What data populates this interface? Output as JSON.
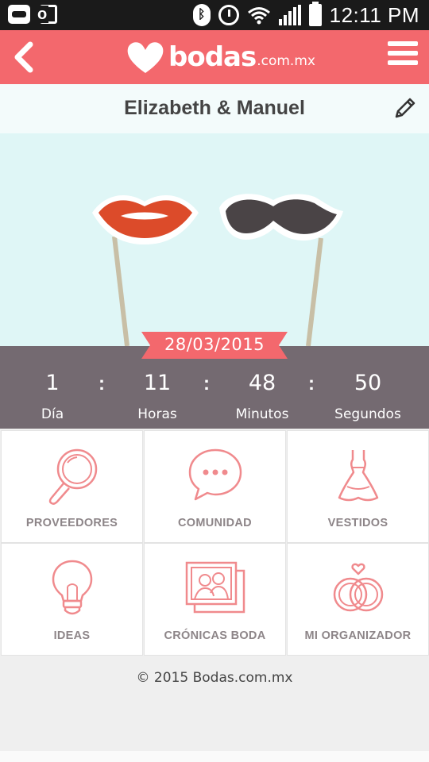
{
  "status_bar": {
    "time": "12:11 PM",
    "icons": [
      "game-controller-icon",
      "outlook-icon",
      "bluetooth-icon",
      "alarm-icon",
      "wifi-icon",
      "signal-icon",
      "battery-icon"
    ]
  },
  "app_bar": {
    "logo_word": "bodas",
    "logo_domain": ".com.mx",
    "back_icon": "chevron-left-icon",
    "menu_icon": "hamburger-menu-icon",
    "color": "#f3686d"
  },
  "couple": {
    "names": "Elizabeth & Manuel",
    "edit_icon": "pencil-icon"
  },
  "hero": {
    "props": [
      "lips-icon",
      "mustache-icon"
    ]
  },
  "countdown": {
    "date": "28/03/2015",
    "units": [
      {
        "value": "1",
        "label": "Día"
      },
      {
        "value": "11",
        "label": "Horas"
      },
      {
        "value": "48",
        "label": "Minutos"
      },
      {
        "value": "50",
        "label": "Segundos"
      }
    ],
    "separator": ":"
  },
  "menu_tiles": [
    {
      "label": "PROVEEDORES",
      "icon": "magnifier-icon"
    },
    {
      "label": "COMUNIDAD",
      "icon": "chat-bubble-icon"
    },
    {
      "label": "VESTIDOS",
      "icon": "dress-icon"
    },
    {
      "label": "IDEAS",
      "icon": "lightbulb-icon"
    },
    {
      "label": "CRÓNICAS BODA",
      "icon": "photos-icon"
    },
    {
      "label": "MI ORGANIZADOR",
      "icon": "rings-icon"
    }
  ],
  "footer": {
    "copyright": "© 2015 Bodas.com.mx"
  },
  "colors": {
    "accent": "#f3686d",
    "countdown_bg": "#746a71",
    "hero_bg": "#dff6f6",
    "icon_stroke": "#f08a8d"
  }
}
